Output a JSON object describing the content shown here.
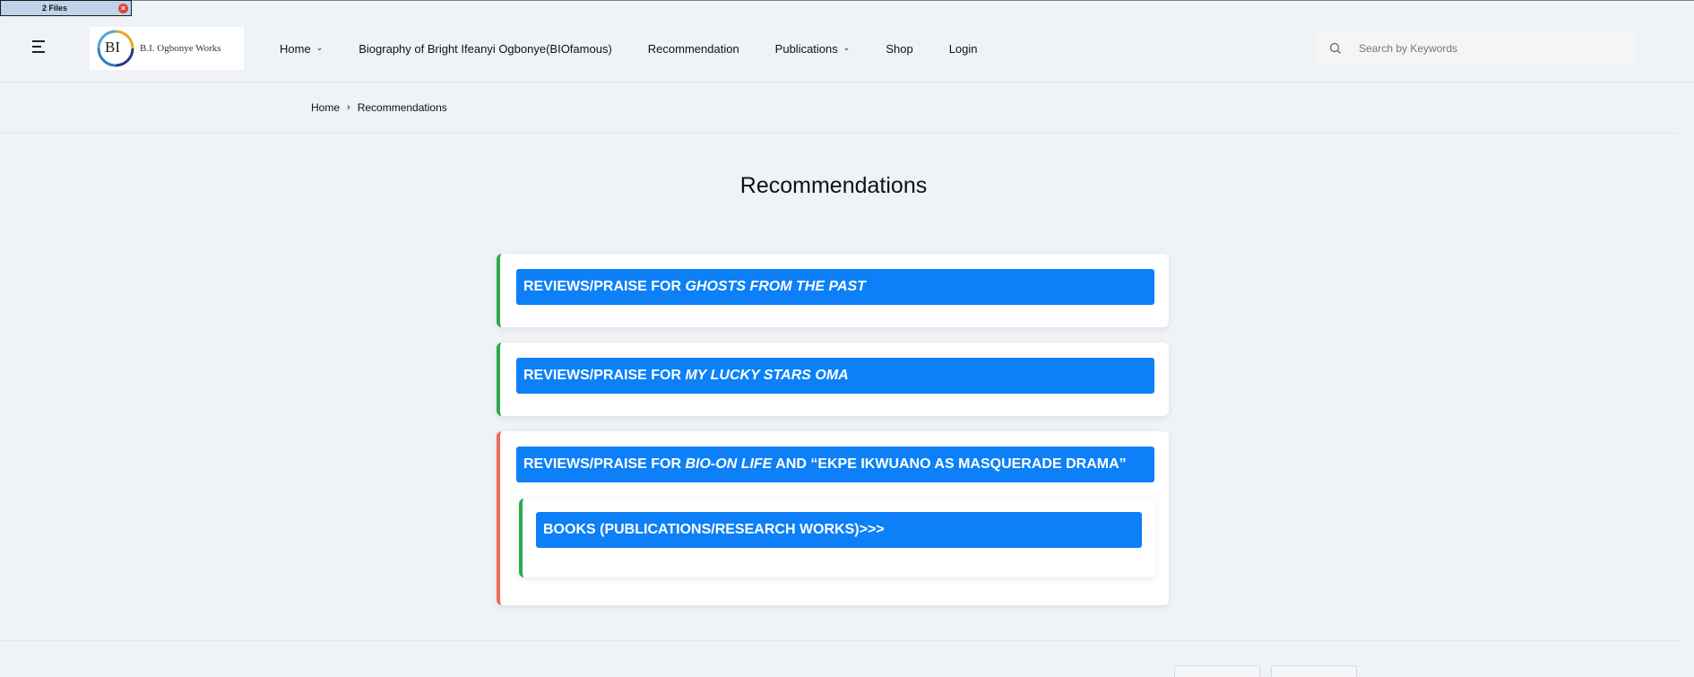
{
  "files_badge": {
    "label": "2 Files",
    "close_glyph": "×"
  },
  "header": {
    "logo_text": "B.I. Ogbonye Works",
    "logo_mark": "BI",
    "nav": [
      {
        "label": "Home",
        "has_dropdown": true
      },
      {
        "label": "Biography of Bright Ifeanyi Ogbonye(BIOfamous)",
        "has_dropdown": false
      },
      {
        "label": "Recommendation",
        "has_dropdown": false
      },
      {
        "label": "Publications",
        "has_dropdown": true
      },
      {
        "label": "Shop",
        "has_dropdown": false
      },
      {
        "label": "Login",
        "has_dropdown": false
      }
    ],
    "search": {
      "placeholder": "Search by Keywords",
      "icon": "search-icon"
    }
  },
  "breadcrumb": {
    "home": "Home",
    "separator": "›",
    "current": "Recommendations"
  },
  "page_title": "Recommendations",
  "cards": [
    {
      "prefix": "REVIEWS/PRAISE FOR ",
      "italic": "GHOSTS FROM THE PAST",
      "suffix": ""
    },
    {
      "prefix": "REVIEWS/PRAISE FOR ",
      "italic": "MY LUCKY STARS OMA",
      "suffix": ""
    },
    {
      "prefix": "REVIEWS/PRAISE FOR ",
      "italic": "BIO-ON LIFE",
      "suffix": " AND “EKPE IKWUANO AS MASQUERADE DRAMA”",
      "child": {
        "label": "BOOKS (PUBLICATIONS/RESEARCH WORKS)>>>"
      }
    }
  ],
  "colors": {
    "accent_blue": "#0d80f7",
    "green_border": "#2eaa4a",
    "red_border": "#ef6a5a",
    "background": "#eff2f6"
  }
}
